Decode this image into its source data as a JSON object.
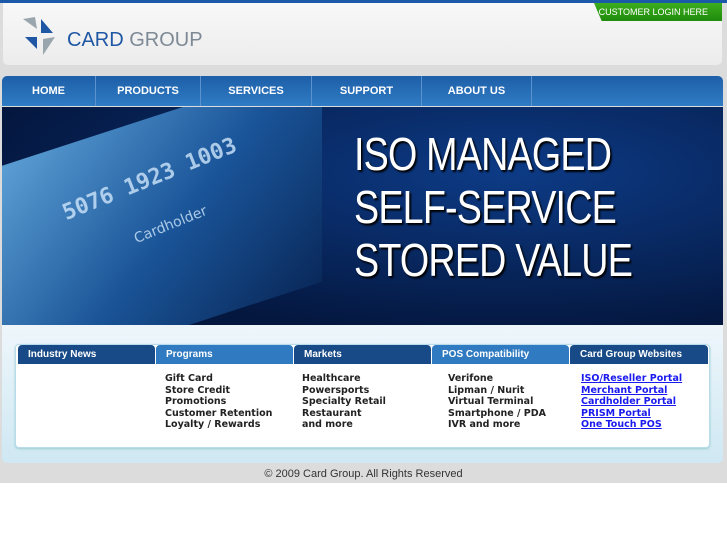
{
  "header": {
    "logo_brand": "CARD",
    "logo_group": "GROUP",
    "login": "CUSTOMER LOGIN HERE"
  },
  "nav": [
    "HOME",
    "PRODUCTS",
    "SERVICES",
    "SUPPORT",
    "ABOUT US"
  ],
  "hero": {
    "lines": [
      "ISO MANAGED",
      "SELF-SERVICE",
      "STORED VALUE"
    ],
    "card_number": "5076 1923 1003",
    "card_name": "Cardholder"
  },
  "tabs": [
    "Industry News",
    "Programs",
    "Markets",
    "POS Compatibility",
    "Card Group Websites"
  ],
  "programs": [
    "Gift Card",
    "Store Credit",
    "Promotions",
    "Customer Retention",
    "Loyalty / Rewards"
  ],
  "markets": [
    "Healthcare",
    "Powersports",
    "Specialty Retail",
    "Restaurant",
    "and more"
  ],
  "pos": [
    "Verifone",
    "Lipman / Nurit",
    "Virtual Terminal",
    "Smartphone / PDA",
    "IVR and more"
  ],
  "websites": [
    "ISO/Reseller Portal",
    "Merchant Portal",
    "Cardholder Portal",
    "PRISM Portal",
    "One Touch POS"
  ],
  "footer": "© 2009 Card Group. All Rights Reserved"
}
